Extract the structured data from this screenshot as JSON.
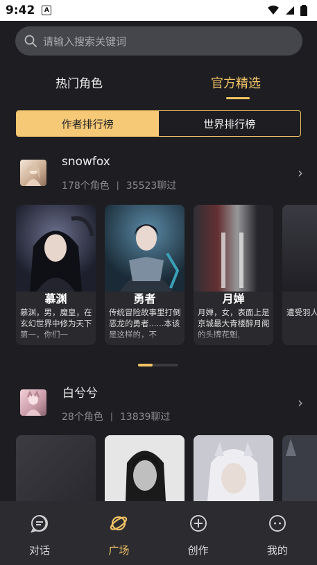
{
  "status_bar": {
    "time": "9:42",
    "a_badge": "A"
  },
  "search": {
    "placeholder": "请输入搜索关键词"
  },
  "tabs": [
    {
      "label": "热门角色",
      "active": false
    },
    {
      "label": "官方精选",
      "active": true
    }
  ],
  "segment": [
    {
      "label": "作者排行榜",
      "active": true
    },
    {
      "label": "世界排行榜",
      "active": false
    }
  ],
  "authors": [
    {
      "name": "snowfox",
      "roles": "178个角色",
      "separator": "|",
      "chats": "35523聊过",
      "cards": [
        {
          "name": "慕渊",
          "desc": "慕渊，男，魔皇，在玄幻世界中修为天下第一，你们一"
        },
        {
          "name": "勇者",
          "desc": "传统冒险故事里打倒恶龙的勇者......本该是这样的，不"
        },
        {
          "name": "月婵",
          "desc": "月婵，女，表面上是京城最大青楼醉月阁的头牌花魁,"
        },
        {
          "name": "",
          "desc": "遭受羽人，E暗的农"
        }
      ]
    },
    {
      "name": "白兮兮",
      "roles": "28个角色",
      "separator": "|",
      "chats": "13839聊过"
    }
  ],
  "bottom_nav": [
    {
      "label": "对话",
      "icon": "chat-icon",
      "active": false
    },
    {
      "label": "广场",
      "icon": "planet-icon",
      "active": true
    },
    {
      "label": "创作",
      "icon": "plus-circle-icon",
      "active": false
    },
    {
      "label": "我的",
      "icon": "profile-icon",
      "active": false
    }
  ],
  "colors": {
    "accent": "#f2c466",
    "background": "#1e1e22",
    "nav_bg": "#2b2b30"
  }
}
